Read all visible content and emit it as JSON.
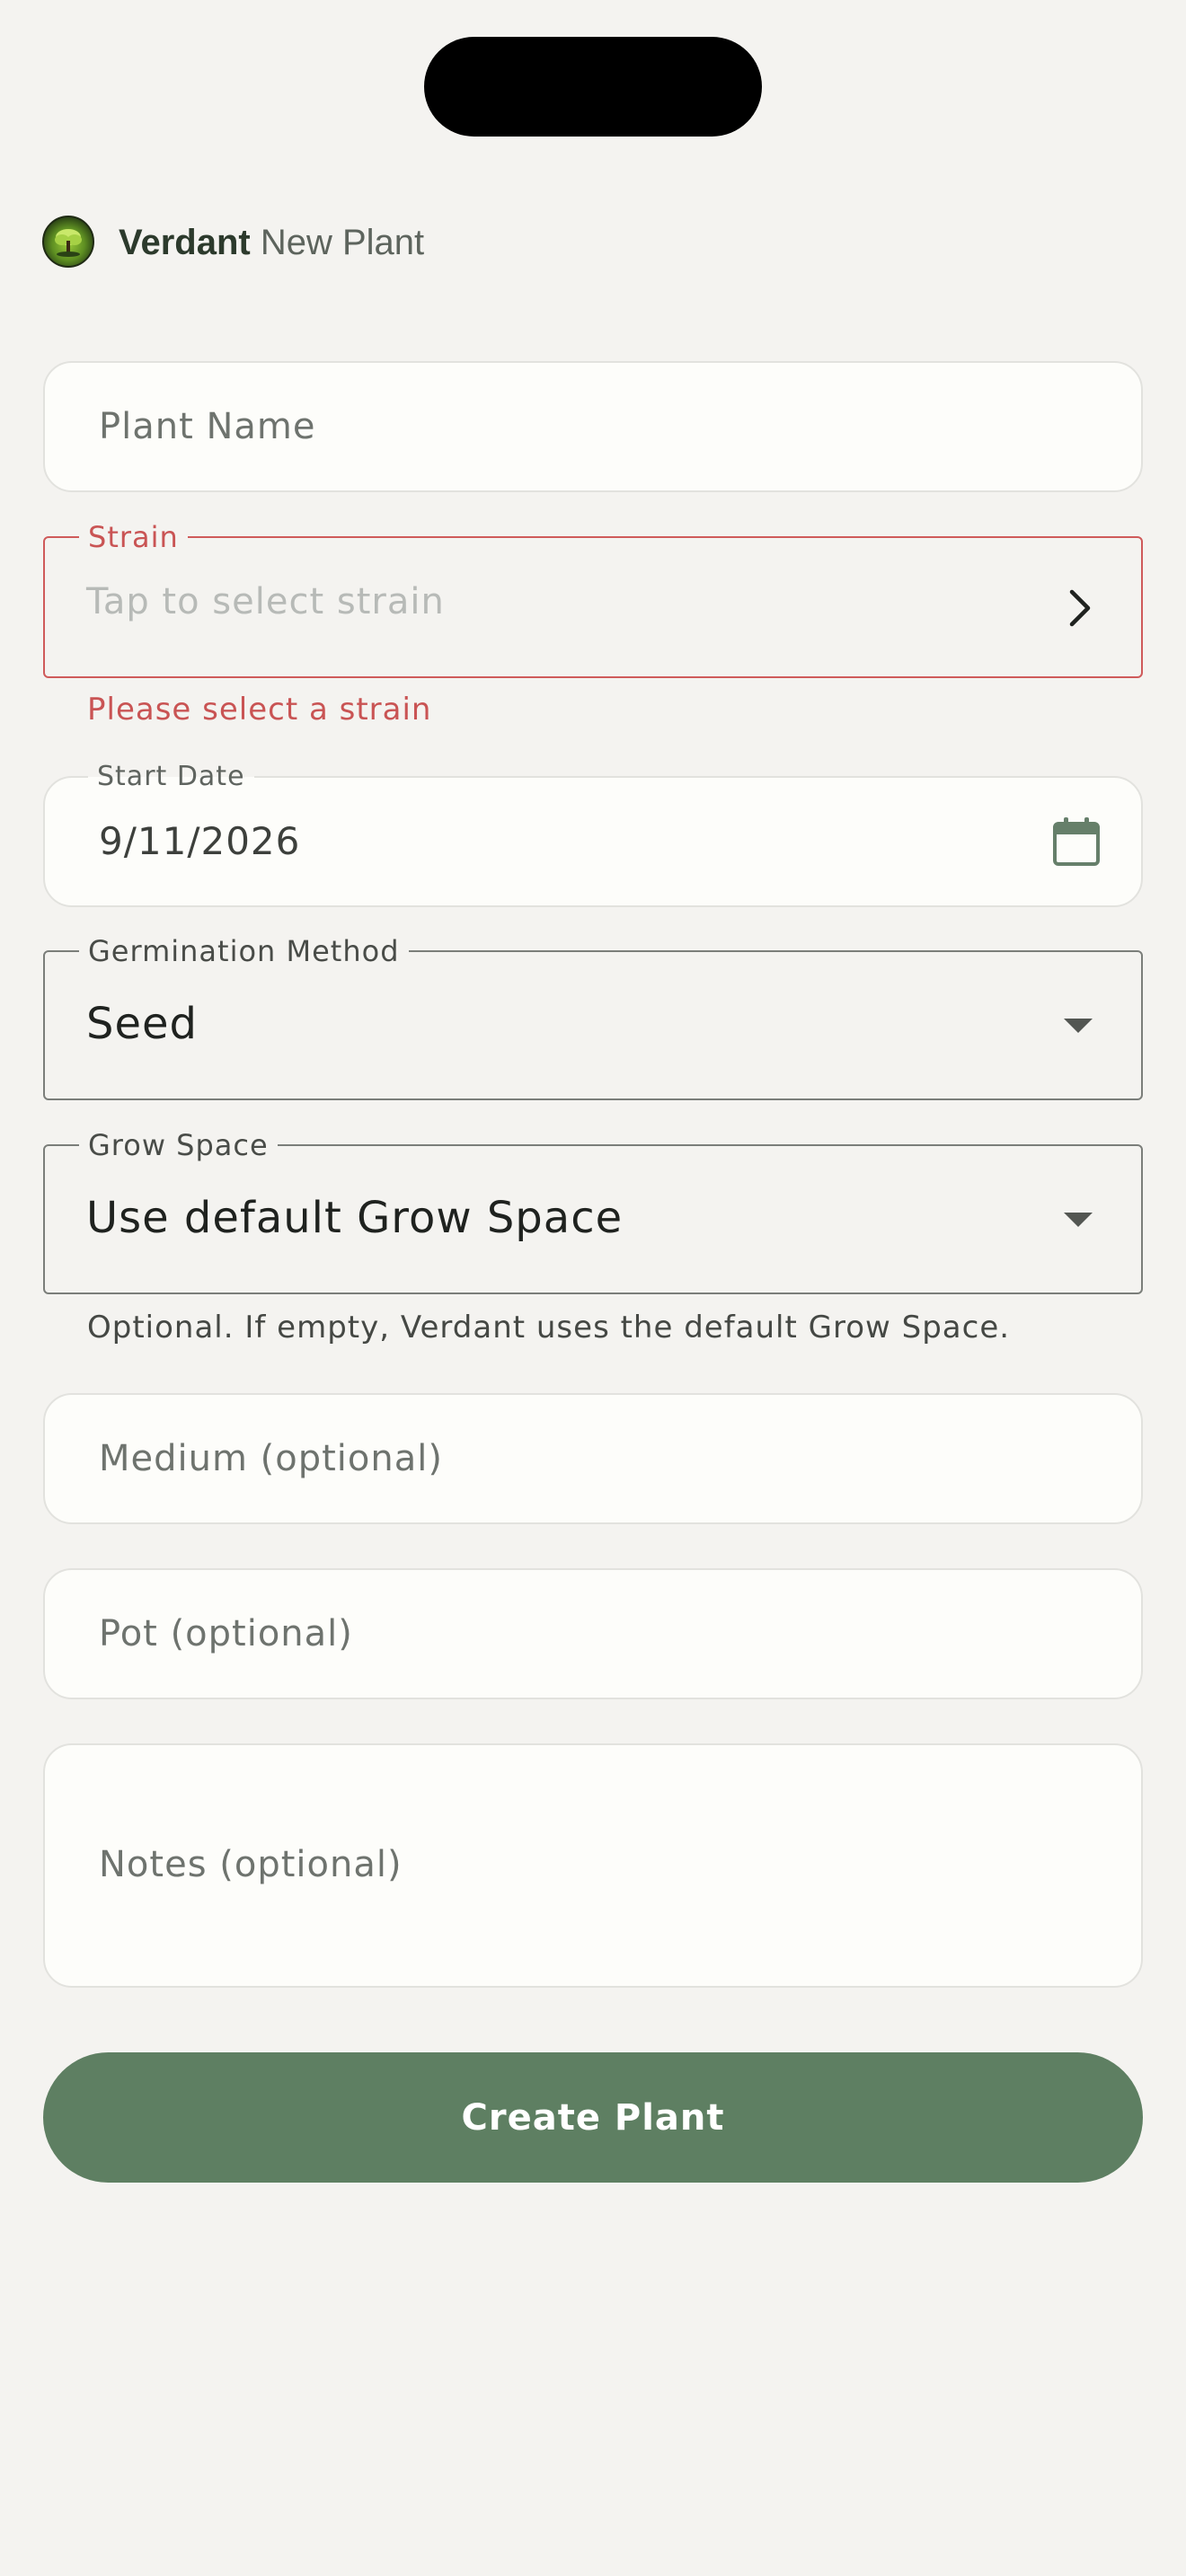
{
  "header": {
    "brand": "Verdant",
    "subtitle": "New Plant"
  },
  "form": {
    "plant_name": {
      "placeholder": "Plant Name",
      "value": ""
    },
    "strain": {
      "label": "Strain",
      "placeholder": "Tap to select strain",
      "error": "Please select a strain"
    },
    "start_date": {
      "label": "Start Date",
      "value": "9/11/2026"
    },
    "germination_method": {
      "label": "Germination Method",
      "value": "Seed"
    },
    "grow_space": {
      "label": "Grow Space",
      "value": "Use default Grow Space",
      "helper": "Optional. If empty, Verdant uses the default Grow Space."
    },
    "medium": {
      "placeholder": "Medium (optional)"
    },
    "pot": {
      "placeholder": "Pot (optional)"
    },
    "notes": {
      "placeholder": "Notes (optional)"
    },
    "submit_label": "Create Plant"
  },
  "icons": {
    "logo": "verdant-tree-logo",
    "strain_chevron": "chevron-right-icon",
    "date": "calendar-icon",
    "dropdown": "caret-down-icon"
  },
  "colors": {
    "accent": "#5e7f62",
    "error": "#c95454",
    "background": "#f4f3f0",
    "field": "#fdfdfa"
  }
}
